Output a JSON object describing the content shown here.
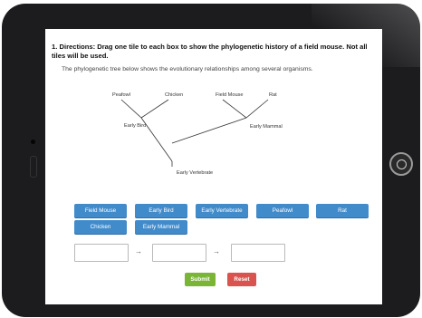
{
  "question": {
    "number": "1.",
    "directions": "Directions: Drag one tile to each box to show the phylogenetic history of a field mouse. Not all tiles will be used.",
    "prompt": "The phylogenetic tree below shows the evolutionary relationships among several organisms."
  },
  "tree": {
    "labels": {
      "peafowl": "Peafowl",
      "chicken": "Chicken",
      "field_mouse": "Field Mouse",
      "rat": "Rat",
      "early_bird": "Early Bird",
      "early_mammal": "Early Mammal",
      "early_vertebrate": "Early Vertebrate"
    }
  },
  "tiles": [
    "Field Mouse",
    "Early Bird",
    "Early Vertebrate",
    "Peafowl",
    "Rat",
    "Chicken",
    "Early Mammal"
  ],
  "drop_arrow": "→",
  "buttons": {
    "submit": "Submit",
    "reset": "Reset"
  },
  "colors": {
    "tile": "#428bca",
    "submit": "#7bb535",
    "reset": "#d9534f"
  }
}
